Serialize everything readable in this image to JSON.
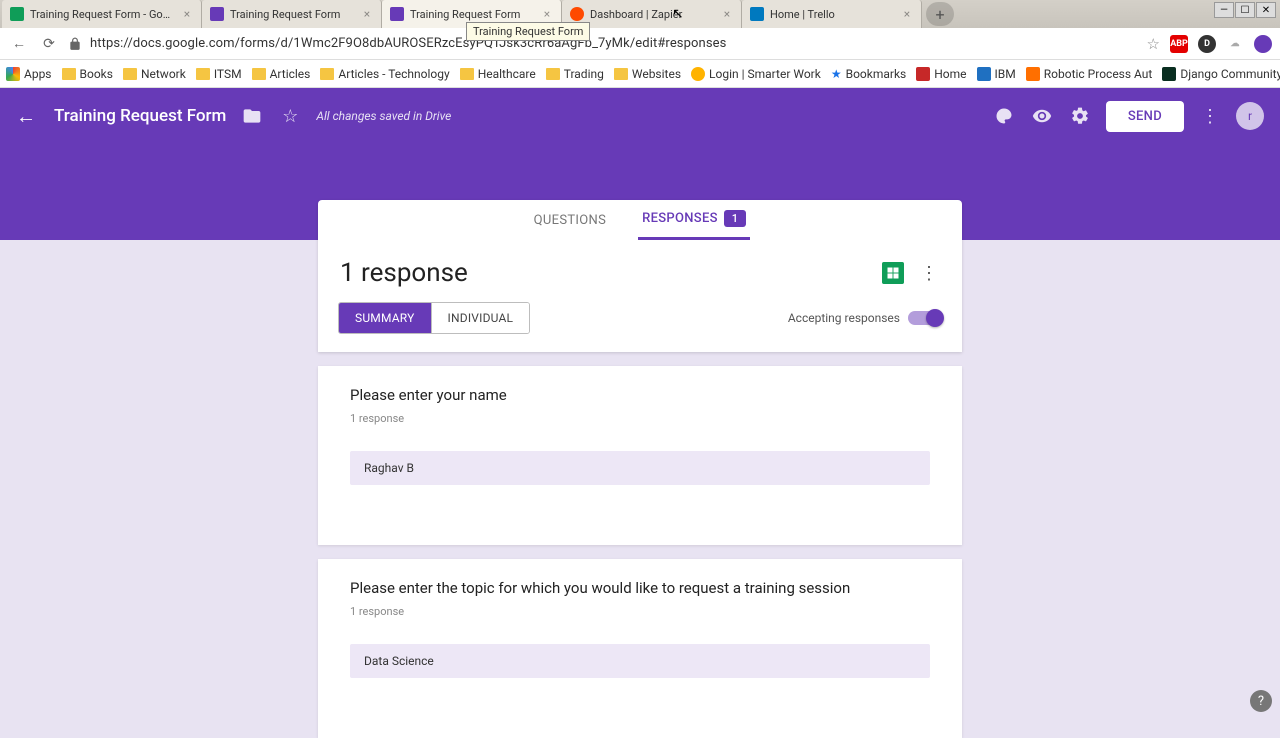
{
  "browser": {
    "tabs": [
      {
        "title": "Training Request Form - Google",
        "active": false,
        "icon": "sheets"
      },
      {
        "title": "Training Request Form",
        "active": false,
        "icon": "forms"
      },
      {
        "title": "Training Request Form",
        "active": true,
        "icon": "forms"
      },
      {
        "title": "Dashboard | Zapier",
        "active": false,
        "icon": "zapier"
      },
      {
        "title": "Home | Trello",
        "active": false,
        "icon": "trello"
      }
    ],
    "tooltip": "Training Request Form",
    "url": "https://docs.google.com/forms/d/1Wmc2F9O8dbAUROSERzcEsyPQTJsk3cRr6aAgFb_7yMk/edit#responses"
  },
  "bookmarks": [
    {
      "label": "Apps",
      "icon": "apps"
    },
    {
      "label": "Books",
      "icon": "folder"
    },
    {
      "label": "Network",
      "icon": "folder"
    },
    {
      "label": "ITSM",
      "icon": "folder"
    },
    {
      "label": "Articles",
      "icon": "folder"
    },
    {
      "label": "Articles - Technology",
      "icon": "folder"
    },
    {
      "label": "Healthcare",
      "icon": "folder"
    },
    {
      "label": "Trading",
      "icon": "folder"
    },
    {
      "label": "Websites",
      "icon": "folder"
    },
    {
      "label": "Login | Smarter Work",
      "icon": "bulb"
    },
    {
      "label": "Bookmarks",
      "icon": "star"
    },
    {
      "label": "Home",
      "icon": "red"
    },
    {
      "label": "IBM",
      "icon": "ibm"
    },
    {
      "label": "Robotic Process Aut",
      "icon": "rpa"
    },
    {
      "label": "Django Community",
      "icon": "django"
    }
  ],
  "header": {
    "title": "Training Request Form",
    "save_status": "All changes saved in Drive",
    "send": "SEND",
    "avatar": "r"
  },
  "tabs": {
    "questions": "QUESTIONS",
    "responses": "RESPONSES",
    "count": "1"
  },
  "responses": {
    "heading": "1 response",
    "summary": "SUMMARY",
    "individual": "INDIVIDUAL",
    "accepting": "Accepting responses"
  },
  "questions": [
    {
      "title": "Please enter your name",
      "sub": "1 response",
      "answer": "Raghav B"
    },
    {
      "title": "Please enter the topic for which you would like to request a training session",
      "sub": "1 response",
      "answer": "Data Science"
    }
  ]
}
